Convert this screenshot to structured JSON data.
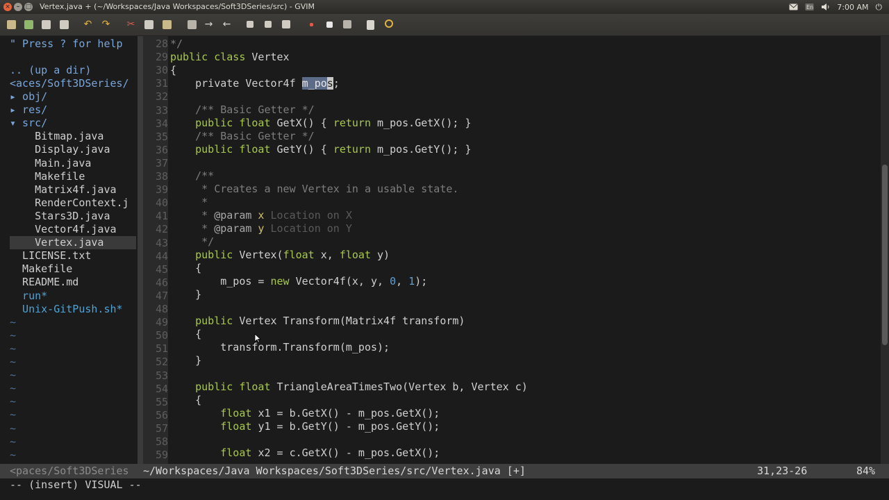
{
  "window": {
    "title": "Vertex.java + (~/Workspaces/Java Workspaces/Soft3DSeries/src) - GVIM",
    "clock": "7:00 AM",
    "close_glyph": "×",
    "min_glyph": "–",
    "max_glyph": "□",
    "power_glyph": "⏻"
  },
  "toolbar": {
    "icons": [
      "open-icon",
      "save-icon",
      "save-all-icon",
      "print-icon",
      "undo-icon",
      "redo-icon",
      "cut-icon",
      "copy-icon",
      "paste-icon",
      "replace-icon",
      "find-next-icon",
      "find-prev-icon",
      "load-session-icon",
      "save-session-icon",
      "run-script-icon",
      "make-icon",
      "shell-icon",
      "ctags-icon",
      "help-icon",
      "find-help-icon"
    ],
    "undo_glyph": "↶",
    "redo_glyph": "↷",
    "cut_glyph": "✂",
    "find_next_glyph": "→",
    "find_prev_glyph": "←"
  },
  "nerdtree": {
    "help": "\" Press ? for help",
    "up_dir": ".. (up a dir)",
    "cwd": "<aces/Soft3DSeries/",
    "items": [
      {
        "text": "▸ obj/",
        "kind": "dir"
      },
      {
        "text": "▸ res/",
        "kind": "dir"
      },
      {
        "text": "▾ src/",
        "kind": "dir"
      },
      {
        "text": "    Bitmap.java",
        "kind": "file"
      },
      {
        "text": "    Display.java",
        "kind": "file"
      },
      {
        "text": "    Main.java",
        "kind": "file"
      },
      {
        "text": "    Makefile",
        "kind": "file"
      },
      {
        "text": "    Matrix4f.java",
        "kind": "file"
      },
      {
        "text": "    RenderContext.j",
        "kind": "file"
      },
      {
        "text": "    Stars3D.java",
        "kind": "file"
      },
      {
        "text": "    Vector4f.java",
        "kind": "file"
      },
      {
        "text": "    Vertex.java",
        "kind": "file-selected"
      },
      {
        "text": "  LICENSE.txt",
        "kind": "file"
      },
      {
        "text": "  Makefile",
        "kind": "file"
      },
      {
        "text": "  README.md",
        "kind": "file"
      },
      {
        "text": "  run*",
        "kind": "exe"
      },
      {
        "text": "  Unix-GitPush.sh*",
        "kind": "exe"
      }
    ],
    "tilde": "~"
  },
  "code": {
    "line_numbers": [
      "28",
      "29",
      "30",
      "31",
      "32",
      "33",
      "34",
      "35",
      "36",
      "37",
      "38",
      "39",
      "40",
      "41",
      "42",
      "43",
      "44",
      "45",
      "46",
      "47",
      "48",
      "49",
      "50",
      "51",
      "52",
      "53",
      "54",
      "55",
      "56",
      "57",
      "58",
      "59"
    ],
    "line_28": "*/",
    "line_29_kw": "public class ",
    "line_29_name": "Vertex",
    "line_30": "{",
    "line_31_pre": "    private Vector4f ",
    "line_31_sel": "m_po",
    "line_31_cursor": "s",
    "line_31_post": ";",
    "line_33": "    /** Basic Getter */",
    "line_34_kw": "    public float ",
    "line_34_rest": "GetX() { ",
    "line_34_ret": "return",
    "line_34_end": " m_pos.GetX(); }",
    "line_35": "    /** Basic Getter */",
    "line_36_kw": "    public float ",
    "line_36_rest": "GetY() { ",
    "line_36_ret": "return",
    "line_36_end": " m_pos.GetY(); }",
    "line_38": "    /**",
    "line_39": "     * Creates a new Vertex in a usable state.",
    "line_40": "     *",
    "line_41_pre": "     * ",
    "line_41_tag": "@param",
    "line_41_var": " x",
    "line_41_desc": " Location on X",
    "line_42_pre": "     * ",
    "line_42_tag": "@param",
    "line_42_var": " y",
    "line_42_desc": " Location on Y",
    "line_43": "     */",
    "line_44_kw": "    public ",
    "line_44_name": "Vertex(",
    "line_44_t1": "float",
    "line_44_mid": " x, ",
    "line_44_t2": "float",
    "line_44_end": " y)",
    "line_45": "    {",
    "line_46_pre": "        m_pos = ",
    "line_46_new": "new",
    "line_46_mid": " Vector4f(x, y, ",
    "line_46_n0": "0",
    "line_46_comma": ", ",
    "line_46_n1": "1",
    "line_46_end": ");",
    "line_47": "    }",
    "line_49_kw": "    public ",
    "line_49_rest": "Vertex Transform(Matrix4f transform)",
    "line_50": "    {",
    "line_51": "        transform.Transform(m_pos);",
    "line_52": "    }",
    "line_54_kw": "    public float ",
    "line_54_rest": "TriangleAreaTimesTwo(Vertex b, Vertex c)",
    "line_55": "    {",
    "line_56_kw": "        float ",
    "line_56_rest": "x1 = b.GetX() - m_pos.GetX();",
    "line_57_kw": "        float ",
    "line_57_rest": "y1 = b.GetY() - m_pos.GetY();",
    "line_59_kw": "        float ",
    "line_59_rest": "x2 = c.GetX() - m_pos.GetX();"
  },
  "statusline": {
    "left": "<paces/Soft3DSeries",
    "file": "~/Workspaces/Java Workspaces/Soft3DSeries/src/Vertex.java [+]",
    "position": "31,23-26",
    "percent": "84%"
  },
  "cmdline": {
    "text": "-- (insert) VISUAL --"
  },
  "colors": {
    "keyword": "#a7c94c",
    "type": "#a7c94c",
    "comment": "#7d7d7d",
    "doc_param": "#d2c06e",
    "number": "#5f9ed4",
    "background": "#1b1b1b"
  }
}
